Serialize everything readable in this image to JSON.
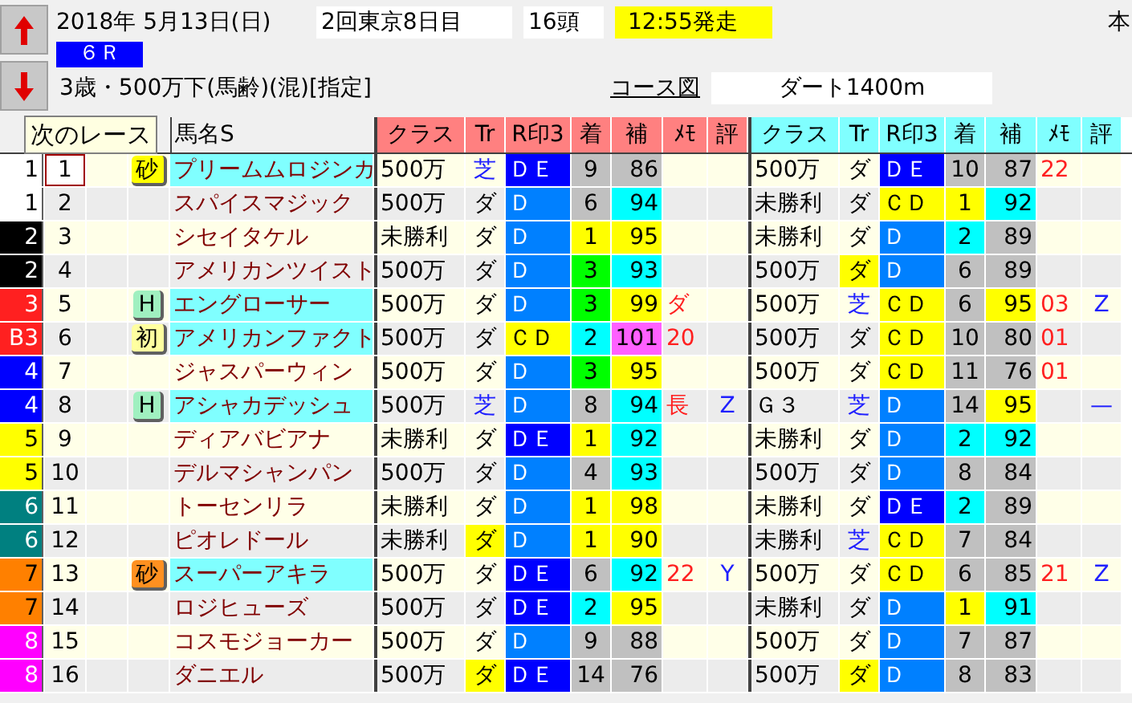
{
  "header": {
    "date": "2018年 5月13日(日)",
    "meeting": "2回東京8日目",
    "runners": "16頭",
    "post_time": "12:55発走",
    "corner_text": "本",
    "race_no": "６Ｒ",
    "conditions": "3歳・500万下(馬齢)(混)[指定]",
    "course_link": "コース図",
    "course": "ダート1400m"
  },
  "tooltip": "次のレース",
  "name_header": "馬名S",
  "blocks": [
    {
      "color": "#ff8080",
      "labels": [
        "クラス",
        "Tr",
        "R印3",
        "着",
        "補",
        "ﾒﾓ",
        "評"
      ]
    },
    {
      "color": "#80ffff",
      "labels": [
        "クラス",
        "Tr",
        "R印3",
        "着",
        "補",
        "ﾒﾓ",
        "評"
      ]
    }
  ],
  "rows": [
    {
      "frame": {
        "text": "1",
        "color": "#ffffff"
      },
      "num": "1",
      "selected": true,
      "mark": {
        "text": "砂",
        "color": "#ffff00"
      },
      "name": "プリームムロジンカ",
      "highlight": true,
      "races": [
        {
          "class": "500万",
          "track": {
            "text": "芝",
            "kind": "turf",
            "marked": false
          },
          "red3": {
            "text": "ＤＥ",
            "color": "#0000ff"
          },
          "finish": {
            "text": "9",
            "color": "#c0c0c0"
          },
          "hosei": {
            "text": "86",
            "color": "#c0c0c0"
          }
        },
        {
          "class": "500万",
          "track": {
            "text": "ダ",
            "kind": "dirt",
            "marked": false
          },
          "red3": {
            "text": "ＤＥ",
            "color": "#0000ff"
          },
          "finish": {
            "text": "10",
            "color": "#c0c0c0"
          },
          "hosei": {
            "text": "87",
            "color": "#c0c0c0"
          },
          "memo": "22"
        }
      ]
    },
    {
      "frame": {
        "text": "1",
        "color": "#ffffff"
      },
      "num": "2",
      "selected": false,
      "name": "スパイスマジック",
      "highlight": false,
      "races": [
        {
          "class": "500万",
          "track": {
            "text": "ダ",
            "kind": "dirt",
            "marked": false
          },
          "red3": {
            "text": "Ｄ",
            "color": "#0080ff"
          },
          "finish": {
            "text": "6",
            "color": "#c0c0c0"
          },
          "hosei": {
            "text": "94",
            "color": "#00ffff"
          }
        },
        {
          "class": "未勝利",
          "track": {
            "text": "ダ",
            "kind": "dirt",
            "marked": false
          },
          "red3": {
            "text": "ＣＤ",
            "color": "#ffff00"
          },
          "finish": {
            "text": "1",
            "color": "#ffff00"
          },
          "hosei": {
            "text": "92",
            "color": "#00ffff"
          }
        }
      ]
    },
    {
      "frame": {
        "text": "2",
        "color": "#000000"
      },
      "num": "3",
      "selected": false,
      "name": "シセイタケル",
      "highlight": false,
      "races": [
        {
          "class": "未勝利",
          "track": {
            "text": "ダ",
            "kind": "dirt",
            "marked": false
          },
          "red3": {
            "text": "Ｄ",
            "color": "#0080ff"
          },
          "finish": {
            "text": "1",
            "color": "#ffff00"
          },
          "hosei": {
            "text": "95",
            "color": "#ffff00"
          }
        },
        {
          "class": "未勝利",
          "track": {
            "text": "ダ",
            "kind": "dirt",
            "marked": false
          },
          "red3": {
            "text": "Ｄ",
            "color": "#0080ff"
          },
          "finish": {
            "text": "2",
            "color": "#00ffff"
          },
          "hosei": {
            "text": "89",
            "color": "#c0c0c0"
          }
        }
      ]
    },
    {
      "frame": {
        "text": "2",
        "color": "#000000"
      },
      "num": "4",
      "selected": false,
      "name": "アメリカンツイスト",
      "highlight": false,
      "races": [
        {
          "class": "500万",
          "track": {
            "text": "ダ",
            "kind": "dirt",
            "marked": false
          },
          "red3": {
            "text": "Ｄ",
            "color": "#0080ff"
          },
          "finish": {
            "text": "3",
            "color": "#00ff00"
          },
          "hosei": {
            "text": "93",
            "color": "#00ffff"
          }
        },
        {
          "class": "500万",
          "track": {
            "text": "ダ",
            "kind": "dirt",
            "marked": true
          },
          "red3": {
            "text": "Ｄ",
            "color": "#0080ff"
          },
          "finish": {
            "text": "6",
            "color": "#c0c0c0"
          },
          "hosei": {
            "text": "89",
            "color": "#c0c0c0"
          }
        }
      ]
    },
    {
      "frame": {
        "text": "3",
        "color": "#ff2020"
      },
      "num": "5",
      "selected": false,
      "mark": {
        "text": "H",
        "color": "#a0f0c0"
      },
      "name": "エングローサー",
      "highlight": true,
      "races": [
        {
          "class": "500万",
          "track": {
            "text": "ダ",
            "kind": "dirt",
            "marked": false
          },
          "red3": {
            "text": "Ｄ",
            "color": "#0080ff"
          },
          "finish": {
            "text": "3",
            "color": "#00ff00"
          },
          "hosei": {
            "text": "99",
            "color": "#ffff00"
          },
          "memo": "ダ"
        },
        {
          "class": "500万",
          "track": {
            "text": "芝",
            "kind": "turf",
            "marked": false
          },
          "red3": {
            "text": "ＣＤ",
            "color": "#ffff00"
          },
          "finish": {
            "text": "6",
            "color": "#c0c0c0"
          },
          "hosei": {
            "text": "95",
            "color": "#ffff00"
          },
          "memo": "03",
          "hyo": "Z"
        }
      ]
    },
    {
      "frame": {
        "text": "B3",
        "color": "#ff2020"
      },
      "num": "6",
      "selected": false,
      "mark": {
        "text": "初",
        "color": "#ffffa0"
      },
      "name": "アメリカンファクト",
      "highlight": true,
      "races": [
        {
          "class": "500万",
          "track": {
            "text": "ダ",
            "kind": "dirt",
            "marked": false
          },
          "red3": {
            "text": "ＣＤ",
            "color": "#ffff00"
          },
          "finish": {
            "text": "2",
            "color": "#00ffff"
          },
          "hosei": {
            "text": "101",
            "color": "#ff60ff"
          },
          "memo": "20"
        },
        {
          "class": "500万",
          "track": {
            "text": "ダ",
            "kind": "dirt",
            "marked": false
          },
          "red3": {
            "text": "ＣＤ",
            "color": "#ffff00"
          },
          "finish": {
            "text": "10",
            "color": "#c0c0c0"
          },
          "hosei": {
            "text": "80",
            "color": "#c0c0c0"
          },
          "memo": "01"
        }
      ]
    },
    {
      "frame": {
        "text": "4",
        "color": "#0000ff"
      },
      "num": "7",
      "selected": false,
      "name": "ジャスパーウィン",
      "highlight": false,
      "races": [
        {
          "class": "500万",
          "track": {
            "text": "ダ",
            "kind": "dirt",
            "marked": false
          },
          "red3": {
            "text": "Ｄ",
            "color": "#0080ff"
          },
          "finish": {
            "text": "3",
            "color": "#00ff00"
          },
          "hosei": {
            "text": "95",
            "color": "#ffff00"
          }
        },
        {
          "class": "500万",
          "track": {
            "text": "ダ",
            "kind": "dirt",
            "marked": false
          },
          "red3": {
            "text": "ＣＤ",
            "color": "#ffff00"
          },
          "finish": {
            "text": "11",
            "color": "#c0c0c0"
          },
          "hosei": {
            "text": "76",
            "color": "#c0c0c0"
          },
          "memo": "01"
        }
      ]
    },
    {
      "frame": {
        "text": "4",
        "color": "#0000ff"
      },
      "num": "8",
      "selected": false,
      "mark": {
        "text": "H",
        "color": "#a0f0c0"
      },
      "name": "アシャカデッシュ",
      "highlight": true,
      "races": [
        {
          "class": "500万",
          "track": {
            "text": "芝",
            "kind": "turf",
            "marked": false
          },
          "red3": {
            "text": "Ｄ",
            "color": "#0080ff"
          },
          "finish": {
            "text": "8",
            "color": "#c0c0c0"
          },
          "hosei": {
            "text": "94",
            "color": "#00ffff"
          },
          "memo": "長",
          "hyo": "Z"
        },
        {
          "class": "Ｇ３",
          "track": {
            "text": "芝",
            "kind": "turf",
            "marked": false
          },
          "red3": {
            "text": "Ｄ",
            "color": "#0080ff"
          },
          "finish": {
            "text": "14",
            "color": "#c0c0c0"
          },
          "hosei": {
            "text": "95",
            "color": "#ffff00"
          },
          "hyo": "—"
        }
      ]
    },
    {
      "frame": {
        "text": "5",
        "color": "#ffff00"
      },
      "num": "9",
      "selected": false,
      "name": "ディアバビアナ",
      "highlight": false,
      "races": [
        {
          "class": "未勝利",
          "track": {
            "text": "ダ",
            "kind": "dirt",
            "marked": false
          },
          "red3": {
            "text": "ＤＥ",
            "color": "#0000ff"
          },
          "finish": {
            "text": "1",
            "color": "#ffff00"
          },
          "hosei": {
            "text": "92",
            "color": "#00ffff"
          }
        },
        {
          "class": "未勝利",
          "track": {
            "text": "ダ",
            "kind": "dirt",
            "marked": false
          },
          "red3": {
            "text": "Ｄ",
            "color": "#0080ff"
          },
          "finish": {
            "text": "2",
            "color": "#00ffff"
          },
          "hosei": {
            "text": "92",
            "color": "#00ffff"
          }
        }
      ]
    },
    {
      "frame": {
        "text": "5",
        "color": "#ffff00"
      },
      "num": "10",
      "selected": false,
      "name": "デルマシャンパン",
      "highlight": false,
      "races": [
        {
          "class": "500万",
          "track": {
            "text": "ダ",
            "kind": "dirt",
            "marked": false
          },
          "red3": {
            "text": "Ｄ",
            "color": "#0080ff"
          },
          "finish": {
            "text": "4",
            "color": "#c0c0c0"
          },
          "hosei": {
            "text": "93",
            "color": "#00ffff"
          }
        },
        {
          "class": "500万",
          "track": {
            "text": "ダ",
            "kind": "dirt",
            "marked": false
          },
          "red3": {
            "text": "Ｄ",
            "color": "#0080ff"
          },
          "finish": {
            "text": "8",
            "color": "#c0c0c0"
          },
          "hosei": {
            "text": "84",
            "color": "#c0c0c0"
          }
        }
      ]
    },
    {
      "frame": {
        "text": "6",
        "color": "#008080"
      },
      "num": "11",
      "selected": false,
      "name": "トーセンリラ",
      "highlight": false,
      "races": [
        {
          "class": "未勝利",
          "track": {
            "text": "ダ",
            "kind": "dirt",
            "marked": false
          },
          "red3": {
            "text": "Ｄ",
            "color": "#0080ff"
          },
          "finish": {
            "text": "1",
            "color": "#ffff00"
          },
          "hosei": {
            "text": "98",
            "color": "#ffff00"
          }
        },
        {
          "class": "未勝利",
          "track": {
            "text": "ダ",
            "kind": "dirt",
            "marked": false
          },
          "red3": {
            "text": "ＤＥ",
            "color": "#0000ff"
          },
          "finish": {
            "text": "2",
            "color": "#00ffff"
          },
          "hosei": {
            "text": "89",
            "color": "#c0c0c0"
          }
        }
      ]
    },
    {
      "frame": {
        "text": "6",
        "color": "#008080"
      },
      "num": "12",
      "selected": false,
      "name": "ピオレドール",
      "highlight": false,
      "races": [
        {
          "class": "未勝利",
          "track": {
            "text": "ダ",
            "kind": "dirt",
            "marked": true
          },
          "red3": {
            "text": "Ｄ",
            "color": "#0080ff"
          },
          "finish": {
            "text": "1",
            "color": "#ffff00"
          },
          "hosei": {
            "text": "90",
            "color": "#ffff00"
          }
        },
        {
          "class": "未勝利",
          "track": {
            "text": "芝",
            "kind": "turf",
            "marked": false
          },
          "red3": {
            "text": "ＣＤ",
            "color": "#ffff00"
          },
          "finish": {
            "text": "7",
            "color": "#c0c0c0"
          },
          "hosei": {
            "text": "84",
            "color": "#c0c0c0"
          }
        }
      ]
    },
    {
      "frame": {
        "text": "7",
        "color": "#ff8000"
      },
      "num": "13",
      "selected": false,
      "mark": {
        "text": "砂",
        "color": "#ff9020"
      },
      "name": "スーパーアキラ",
      "highlight": true,
      "races": [
        {
          "class": "500万",
          "track": {
            "text": "ダ",
            "kind": "dirt",
            "marked": false
          },
          "red3": {
            "text": "ＤＥ",
            "color": "#0000ff"
          },
          "finish": {
            "text": "6",
            "color": "#c0c0c0"
          },
          "hosei": {
            "text": "92",
            "color": "#00ffff"
          },
          "memo": "22",
          "hyo": "Y"
        },
        {
          "class": "500万",
          "track": {
            "text": "ダ",
            "kind": "dirt",
            "marked": false
          },
          "red3": {
            "text": "ＣＤ",
            "color": "#ffff00"
          },
          "finish": {
            "text": "6",
            "color": "#c0c0c0"
          },
          "hosei": {
            "text": "85",
            "color": "#c0c0c0"
          },
          "memo": "21",
          "hyo": "Z"
        }
      ]
    },
    {
      "frame": {
        "text": "7",
        "color": "#ff8000"
      },
      "num": "14",
      "selected": false,
      "name": "ロジヒューズ",
      "highlight": false,
      "races": [
        {
          "class": "500万",
          "track": {
            "text": "ダ",
            "kind": "dirt",
            "marked": false
          },
          "red3": {
            "text": "ＤＥ",
            "color": "#0000ff"
          },
          "finish": {
            "text": "2",
            "color": "#00ffff"
          },
          "hosei": {
            "text": "95",
            "color": "#ffff00"
          }
        },
        {
          "class": "未勝利",
          "track": {
            "text": "ダ",
            "kind": "dirt",
            "marked": false
          },
          "red3": {
            "text": "Ｄ",
            "color": "#0080ff"
          },
          "finish": {
            "text": "1",
            "color": "#ffff00"
          },
          "hosei": {
            "text": "91",
            "color": "#00ffff"
          }
        }
      ]
    },
    {
      "frame": {
        "text": "8",
        "color": "#ff00ff"
      },
      "num": "15",
      "selected": false,
      "name": "コスモジョーカー",
      "highlight": false,
      "races": [
        {
          "class": "500万",
          "track": {
            "text": "ダ",
            "kind": "dirt",
            "marked": false
          },
          "red3": {
            "text": "Ｄ",
            "color": "#0080ff"
          },
          "finish": {
            "text": "9",
            "color": "#c0c0c0"
          },
          "hosei": {
            "text": "88",
            "color": "#c0c0c0"
          }
        },
        {
          "class": "500万",
          "track": {
            "text": "ダ",
            "kind": "dirt",
            "marked": false
          },
          "red3": {
            "text": "Ｄ",
            "color": "#0080ff"
          },
          "finish": {
            "text": "7",
            "color": "#c0c0c0"
          },
          "hosei": {
            "text": "87",
            "color": "#c0c0c0"
          }
        }
      ]
    },
    {
      "frame": {
        "text": "8",
        "color": "#ff00ff"
      },
      "num": "16",
      "selected": false,
      "name": "ダニエル",
      "highlight": false,
      "races": [
        {
          "class": "500万",
          "track": {
            "text": "ダ",
            "kind": "dirt",
            "marked": true
          },
          "red3": {
            "text": "ＤＥ",
            "color": "#0000ff"
          },
          "finish": {
            "text": "14",
            "color": "#c0c0c0"
          },
          "hosei": {
            "text": "76",
            "color": "#c0c0c0"
          }
        },
        {
          "class": "500万",
          "track": {
            "text": "ダ",
            "kind": "dirt",
            "marked": true
          },
          "red3": {
            "text": "Ｄ",
            "color": "#0080ff"
          },
          "finish": {
            "text": "8",
            "color": "#c0c0c0"
          },
          "hosei": {
            "text": "83",
            "color": "#c0c0c0"
          }
        }
      ]
    }
  ]
}
